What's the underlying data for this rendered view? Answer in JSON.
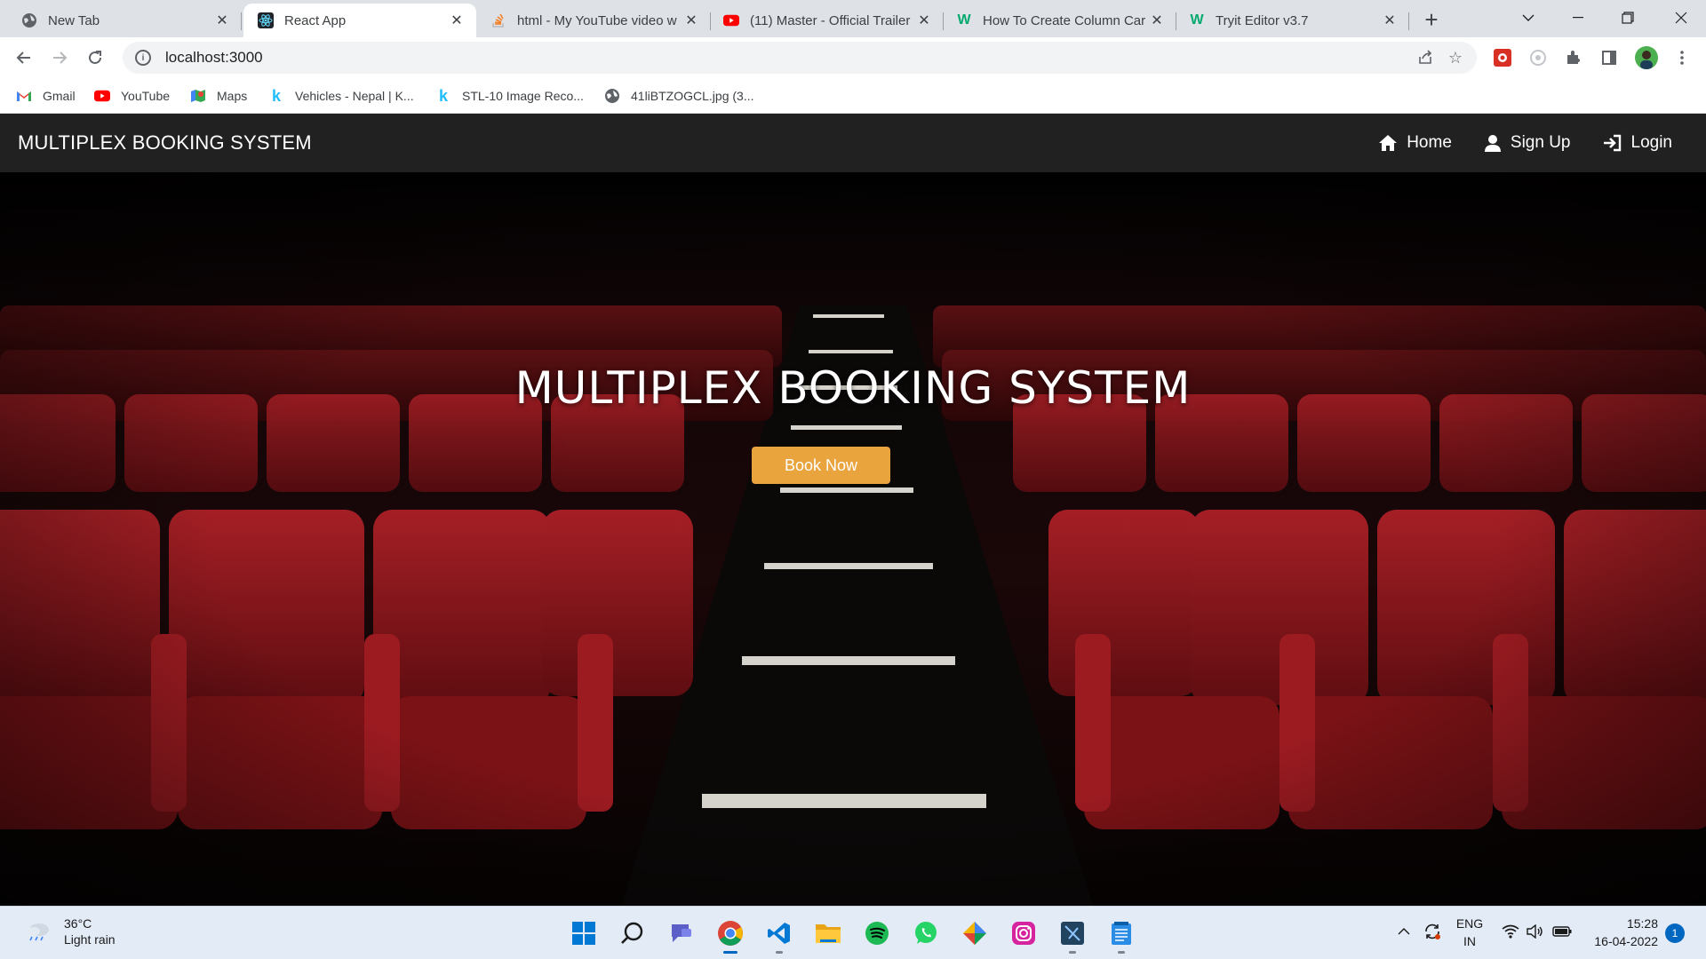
{
  "browser": {
    "tabs": [
      {
        "title": "New Tab",
        "icon": "chrome-newtab-icon"
      },
      {
        "title": "React App",
        "icon": "react-icon"
      },
      {
        "title": "html - My YouTube video w",
        "icon": "stackoverflow-icon"
      },
      {
        "title": "(11) Master - Official Trailer",
        "icon": "youtube-icon"
      },
      {
        "title": "How To Create Column Car",
        "icon": "w3schools-icon"
      },
      {
        "title": "Tryit Editor v3.7",
        "icon": "w3schools-icon"
      }
    ],
    "active_tab": 1,
    "url": "localhost:3000",
    "bookmarks": [
      {
        "label": "Gmail"
      },
      {
        "label": "YouTube"
      },
      {
        "label": "Maps"
      },
      {
        "label": "Vehicles - Nepal | K..."
      },
      {
        "label": "STL-10 Image Reco..."
      },
      {
        "label": "41liBTZOGCL.jpg (3..."
      }
    ]
  },
  "app": {
    "brand": "MULTIPLEX BOOKING SYSTEM",
    "nav": [
      {
        "label": "Home",
        "icon": "home-icon"
      },
      {
        "label": "Sign Up",
        "icon": "user-icon"
      },
      {
        "label": "Login",
        "icon": "login-icon"
      }
    ],
    "hero": {
      "title": "MULTIPLEX BOOKING SYSTEM",
      "cta": "Book Now"
    },
    "colors": {
      "nav_bg": "#212121",
      "cta": "#e9a43d",
      "seat": "#8e1a1f"
    }
  },
  "taskbar": {
    "weather": {
      "temp": "36°C",
      "desc": "Light rain"
    },
    "lang": {
      "line1": "ENG",
      "line2": "IN"
    },
    "clock": {
      "time": "15:28",
      "date": "16-04-2022"
    },
    "notifications": "1"
  }
}
